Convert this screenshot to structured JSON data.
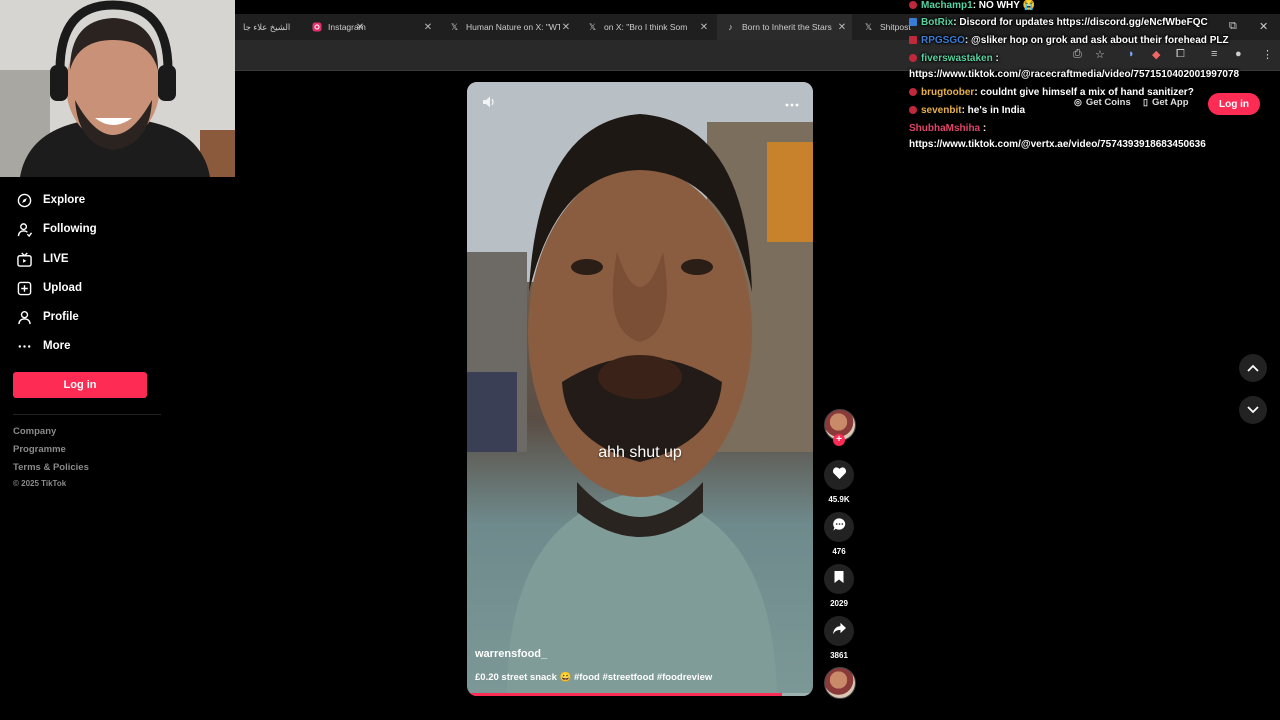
{
  "browser": {
    "tabs": [
      {
        "title": "الشيخ علاء جا",
        "icon": ""
      },
      {
        "title": "Instagram",
        "icon": "instagram-icon"
      },
      {
        "title": "Human Nature on X: \"WT",
        "icon": "x-icon"
      },
      {
        "title": "on X: \"Bro I think Som",
        "icon": "x-icon"
      },
      {
        "title": "Born to Inherit the Stars",
        "icon": "tiktok-icon"
      },
      {
        "title": "Shitpost",
        "icon": "x-icon"
      }
    ]
  },
  "sidebar": {
    "items": [
      {
        "label": "Explore",
        "icon": "compass-icon"
      },
      {
        "label": "Following",
        "icon": "following-icon"
      },
      {
        "label": "LIVE",
        "icon": "live-icon"
      },
      {
        "label": "Upload",
        "icon": "upload-icon"
      },
      {
        "label": "Profile",
        "icon": "profile-icon"
      },
      {
        "label": "More",
        "icon": "more-icon"
      }
    ],
    "login_label": "Log in",
    "footer_links": [
      "Company",
      "Programme",
      "Terms & Policies"
    ],
    "copyright": "© 2025 TikTok"
  },
  "video": {
    "caption": "ahh shut up",
    "author": "warrensfood_",
    "description": "£0.20 street snack 😀 #food #streetfood #foodreview",
    "progress": 0.91
  },
  "actions": {
    "likes": "45.9K",
    "comments": "476",
    "saves": "2029",
    "shares": "3861"
  },
  "topbar": {
    "get_coins": "Get Coins",
    "get_app": "Get App",
    "login": "Log in"
  },
  "chat": [
    {
      "user": "Machamp1",
      "text": ": NO WHY 😭",
      "color": "#5ad1a0",
      "badge": "#c0283b"
    },
    {
      "user": "BotRix",
      "text": ": Discord for updates https://discord.gg/eNcfWbeFQC",
      "color": "#5ad1a0",
      "badge": "#3a7bd5"
    },
    {
      "user": "RPGSGO",
      "text": ": @sliker hop on grok and ask about their forehead PLZ",
      "color": "#3a7bd5",
      "badge": "#c0283b"
    },
    {
      "user": "fiverswastaken",
      "text": " :",
      "color": "#5ad1a0",
      "badge": "#c0283b"
    },
    {
      "user": "",
      "text": "https://www.tiktok.com/@racecraftmedia/video/7571510402001997078",
      "color": "#ffffff",
      "badge": ""
    },
    {
      "user": "brugtoober",
      "text": ": couldnt give himself a mix of hand sanitizer?",
      "color": "#e8b04a",
      "badge": "#c0283b"
    },
    {
      "user": "sevenbit",
      "text": ": he's in India",
      "color": "#e8b04a",
      "badge": "#c0283b"
    },
    {
      "user": "ShubhaMshiha",
      "text": " :",
      "color": "#e0446a",
      "badge": ""
    },
    {
      "user": "",
      "text": "https://www.tiktok.com/@vertx.ae/video/7574393918683450636",
      "color": "#ffffff",
      "badge": ""
    }
  ],
  "colors": {
    "accent": "#fe2c55",
    "background": "#000000"
  }
}
